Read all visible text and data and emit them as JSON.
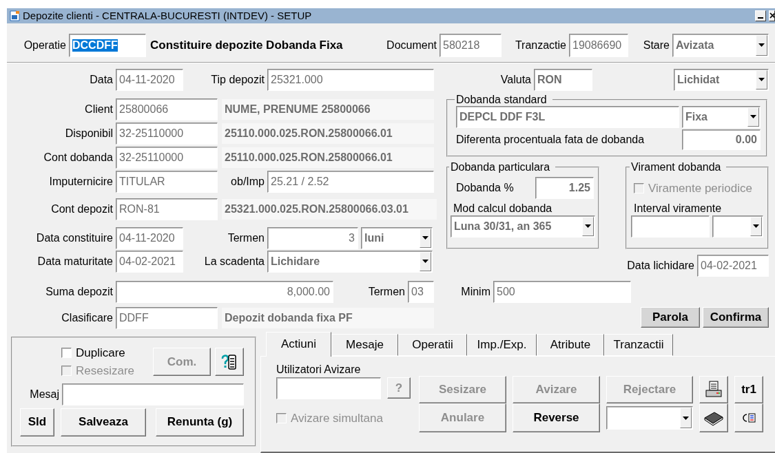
{
  "window": {
    "title": "Depozite clienti - CENTRALA-BUCURESTI (INTDEV) - SETUP"
  },
  "header": {
    "operation": {
      "label": "Operatie",
      "value": "DCCDFF",
      "selected": true
    },
    "operation_name": "Constituire depozite Dobanda Fixa",
    "document": {
      "label": "Document",
      "value": "580218"
    },
    "transaction": {
      "label": "Tranzactie",
      "value": "19086690"
    },
    "status": {
      "label": "Stare",
      "value": "Avizata"
    }
  },
  "deposit": {
    "date": {
      "label": "Data",
      "value": "04-11-2020"
    },
    "deposit_type": {
      "label": "Tip depozit",
      "value": "25321.000"
    },
    "client": {
      "label": "Client",
      "value": "25800066",
      "description": "NUME, PRENUME 25800066"
    },
    "available": {
      "label": "Disponibil",
      "value": "32-25110000",
      "description": "25110.000.025.RON.25800066.01"
    },
    "interest_account": {
      "label": "Cont dobanda",
      "value": "32-25110000",
      "description": "25110.000.025.RON.25800066.01"
    },
    "proxy": {
      "label": "Imputernicire",
      "value": "TITULAR"
    },
    "interest_proxy": {
      "label": "ob/Imp",
      "value": "25.21 / 2.52"
    },
    "deposit_account": {
      "label": "Cont depozit",
      "value": "RON-81",
      "description": "25321.000.025.RON.25800066.03.01"
    },
    "creation_date": {
      "label": "Data constituire",
      "value": "04-11-2020"
    },
    "term": {
      "label": "Termen",
      "value": "3",
      "unit": "luni"
    },
    "maturity_date": {
      "label": "Data maturitate",
      "value": "04-02-2021"
    },
    "at_maturity": {
      "label": "La scadenta",
      "value": "Lichidare"
    },
    "amount": {
      "label": "Suma depozit",
      "value": "8,000.00"
    },
    "term_code": {
      "label": "Termen",
      "value": "03"
    },
    "classification": {
      "label": "Clasificare",
      "value": "DDFF",
      "description": "Depozit dobanda fixa PF"
    }
  },
  "settings": {
    "currency": {
      "label": "Valuta",
      "value": "RON"
    },
    "state": "Lichidat",
    "standard_interest": {
      "title": "Dobanda standard",
      "value": "DEPCL DDF F3L",
      "type": "Fixa",
      "difference_label": "Diferenta procentuala fata de dobanda",
      "difference": "0.00"
    },
    "particular_interest": {
      "title": "Dobanda particulara",
      "rate_label": "Dobanda %",
      "rate": "1.25",
      "mode_label": "Mod calcul dobanda",
      "mode": "Luna 30/31, an 365"
    },
    "interest_transfer": {
      "title": "Virament dobanda",
      "periodic": {
        "label": "Viramente periodice",
        "checked": false,
        "disabled": true
      },
      "interval_label": "Interval viramente"
    },
    "liquidation_date": {
      "label": "Data lichidare",
      "value": "04-02-2021"
    },
    "minimum": {
      "label": "Minim",
      "value": "500"
    },
    "buttons": [
      {
        "label": "Parola",
        "disabled": false
      },
      {
        "label": "Confirma",
        "disabled": false
      }
    ]
  },
  "message_panel": {
    "checkboxes": [
      {
        "label": "Duplicare",
        "checked": false,
        "disabled": false
      },
      {
        "label": "Resesizare",
        "checked": false,
        "disabled": true
      }
    ],
    "comment_button": {
      "label": "Com.",
      "disabled": true
    },
    "message_label": "Mesaj",
    "buttons": [
      {
        "label": "Sld",
        "disabled": false
      },
      {
        "label": "Salveaza",
        "disabled": false
      },
      {
        "label": "Renunta (g)",
        "disabled": false
      }
    ]
  },
  "tabs": [
    {
      "label": "Actiuni",
      "selected": true
    },
    {
      "label": "Mesaje",
      "selected": false
    },
    {
      "label": "Operatii",
      "selected": false
    },
    {
      "label": "Imp./Exp.",
      "selected": false
    },
    {
      "label": "Atribute",
      "selected": false
    },
    {
      "label": "Tranzactii",
      "selected": false
    }
  ],
  "actions": {
    "approvers_label": "Utilizatori Avizare",
    "help_button": {
      "label": "?",
      "disabled": true
    },
    "simultaneous": {
      "label": "Avizare simultana",
      "checked": false,
      "disabled": true
    },
    "buttons": [
      {
        "label": "Sesizare",
        "disabled": true
      },
      {
        "label": "Avizare",
        "disabled": true
      },
      {
        "label": "Rejectare",
        "disabled": true
      },
      {
        "label": "Anulare",
        "disabled": true
      },
      {
        "label": "Reverse",
        "disabled": false
      }
    ],
    "tr_button": "tr1"
  }
}
